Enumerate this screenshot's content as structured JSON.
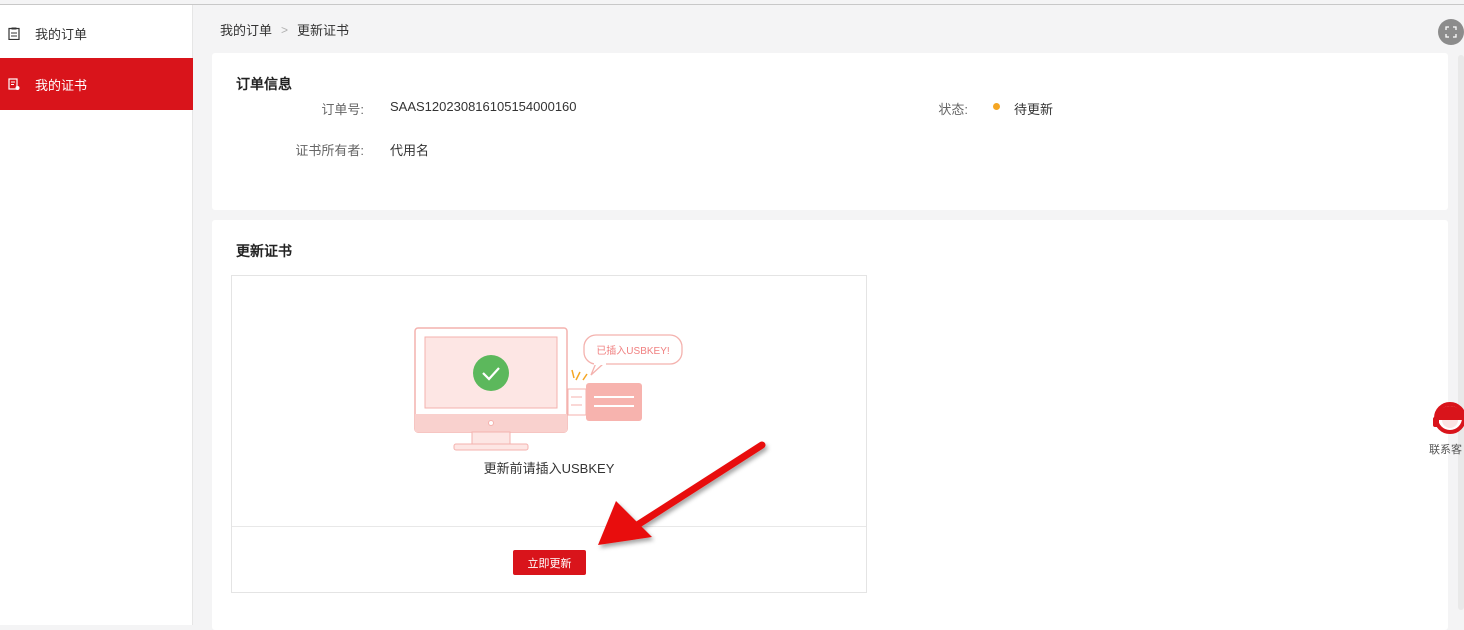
{
  "sidebar": {
    "items": [
      {
        "label": "我的订单",
        "icon": "clipboard-icon",
        "active": false
      },
      {
        "label": "我的证书",
        "icon": "certificate-icon",
        "active": true
      }
    ]
  },
  "breadcrumb": {
    "items": [
      "我的订单",
      "更新证书"
    ],
    "separator": ">"
  },
  "order_info": {
    "title": "订单信息",
    "order_no_label": "订单号:",
    "order_no": "SAAS120230816105154000160",
    "status_label": "状态:",
    "status": "待更新",
    "status_color": "#f5a623",
    "owner_label": "证书所有者:",
    "owner": "代用名"
  },
  "update_cert": {
    "title": "更新证书",
    "bubble_text": "已插入USBKEY!",
    "hint": "更新前请插入USBKEY",
    "button_label": "立即更新"
  },
  "customer_service": {
    "label": "联系客"
  },
  "colors": {
    "accent": "#d9141b",
    "success": "#5cb85c",
    "illustration": "#f4b2ae"
  }
}
